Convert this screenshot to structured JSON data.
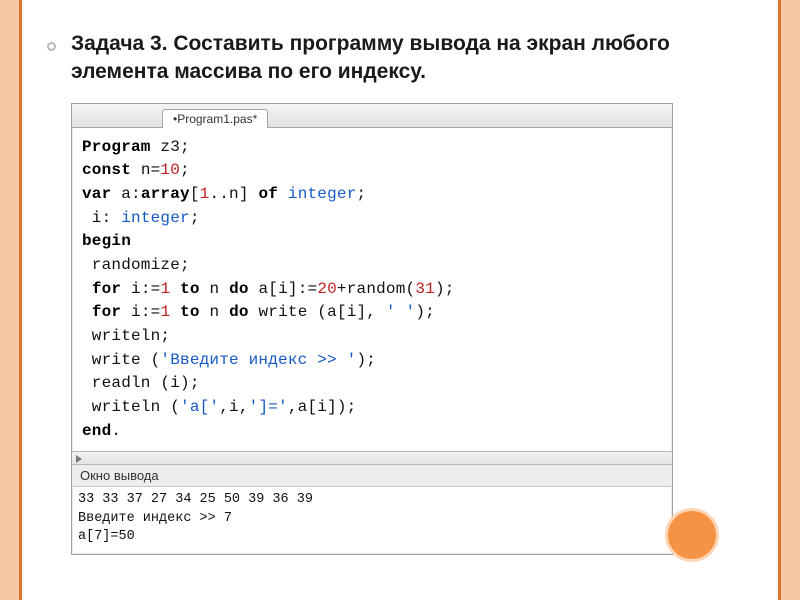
{
  "heading": "Задача 3. Составить программу вывода на экран любого элемента массива по его индексу.",
  "ide": {
    "tab": "•Program1.pas*",
    "output_panel_title": "Окно вывода"
  },
  "code": {
    "l1": {
      "kw1": "Program",
      "name": " z3;"
    },
    "l2": {
      "kw1": "const",
      "pre": " n=",
      "n": "10",
      "post": ";"
    },
    "l3": {
      "kw1": "var",
      "mid1": " a:",
      "kw2": "array",
      "mid2": "[",
      "one": "1",
      "mid3": "..n] ",
      "kw3": "of",
      "sp": " ",
      "typ": "integer",
      "post": ";"
    },
    "l4": {
      "pre": " i: ",
      "typ": "integer",
      "post": ";"
    },
    "l5": {
      "kw1": "begin"
    },
    "l6": {
      "txt": " randomize;"
    },
    "l7": {
      "pre": " ",
      "kw1": "for",
      "mid1": " i:=",
      "one": "1",
      "sp": " ",
      "kw2": "to",
      "mid2": " n ",
      "kw3": "do",
      "mid3": " a[i]:=",
      "n20": "20",
      "mid4": "+random(",
      "n31": "31",
      "post": ");"
    },
    "l8": {
      "pre": " ",
      "kw1": "for",
      "mid1": " i:=",
      "one": "1",
      "sp": " ",
      "kw2": "to",
      "mid2": " n ",
      "kw3": "do",
      "mid3": " write (a[i], ",
      "str": "' '",
      "post": ");"
    },
    "l9": {
      "txt": " writeln;"
    },
    "l10": {
      "pre": " write (",
      "str": "'Введите индекс >> '",
      "post": ");"
    },
    "l11": {
      "txt": " readln (i);"
    },
    "l12": {
      "pre": " writeln (",
      "s1": "'a['",
      "m1": ",i,",
      "s2": "']='",
      "post": ",a[i]);"
    },
    "l13": {
      "kw1": "end",
      "post": "."
    }
  },
  "output": {
    "line1": "33 33 37 27 34 25 50 39 36 39",
    "line2": "Введите индекс >> 7",
    "line3": "a[7]=50"
  }
}
